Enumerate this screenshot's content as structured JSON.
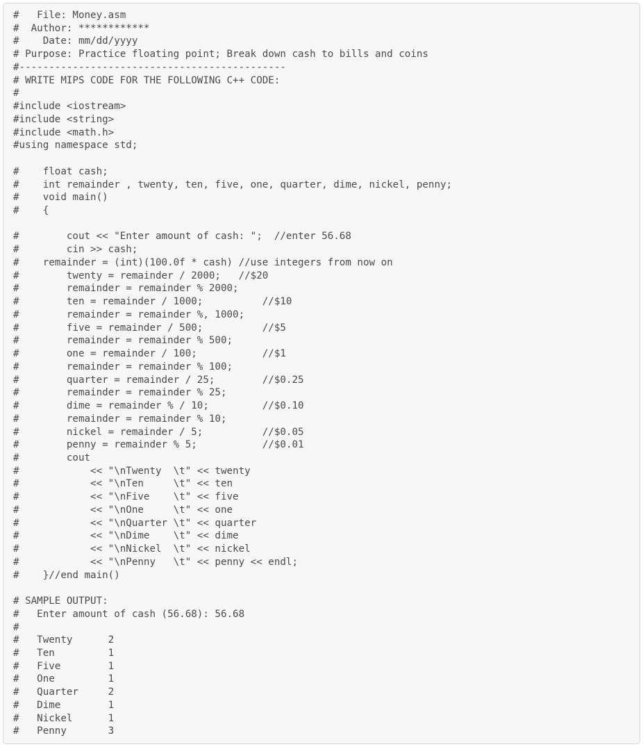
{
  "code_lines": [
    "#   File: Money.asm",
    "#  Author: ************",
    "#    Date: mm/dd/yyyy",
    "# Purpose: Practice floating point; Break down cash to bills and coins",
    "#---------------------------------------------",
    "# WRITE MIPS CODE FOR THE FOLLOWING C++ CODE:",
    "#",
    "#include <iostream>",
    "#include <string>",
    "#include <math.h>",
    "#using namespace std;",
    "",
    "#    float cash;",
    "#    int remainder , twenty, ten, five, one, quarter, dime, nickel, penny;",
    "#    void main()",
    "#    {",
    "",
    "#        cout << \"Enter amount of cash: \";  //enter 56.68",
    "#        cin >> cash;",
    "#    remainder = (int)(100.0f * cash) //use integers from now on",
    "#        twenty = remainder / 2000;   //$20",
    "#        remainder = remainder % 2000;",
    "#        ten = remainder / 1000;          //$10",
    "#        remainder = remainder %, 1000;",
    "#        five = remainder / 500;          //$5",
    "#        remainder = remainder % 500;",
    "#        one = remainder / 100;           //$1",
    "#        remainder = remainder % 100;",
    "#        quarter = remainder / 25;        //$0.25",
    "#        remainder = remainder % 25;",
    "#        dime = remainder % / 10;         //$0.10",
    "#        remainder = remainder % 10;",
    "#        nickel = remainder / 5;          //$0.05",
    "#        penny = remainder % 5;           //$0.01",
    "#        cout",
    "#            << \"\\nTwenty  \\t\" << twenty",
    "#            << \"\\nTen     \\t\" << ten",
    "#            << \"\\nFive    \\t\" << five",
    "#            << \"\\nOne     \\t\" << one",
    "#            << \"\\nQuarter \\t\" << quarter",
    "#            << \"\\nDime    \\t\" << dime",
    "#            << \"\\nNickel  \\t\" << nickel",
    "#            << \"\\nPenny   \\t\" << penny << endl;",
    "#    }//end main()",
    "",
    "# SAMPLE OUTPUT:",
    "#   Enter amount of cash (56.68): 56.68",
    "#",
    "#   Twenty      2",
    "#   Ten         1",
    "#   Five        1",
    "#   One         1",
    "#   Quarter     2",
    "#   Dime        1",
    "#   Nickel      1",
    "#   Penny       3"
  ]
}
